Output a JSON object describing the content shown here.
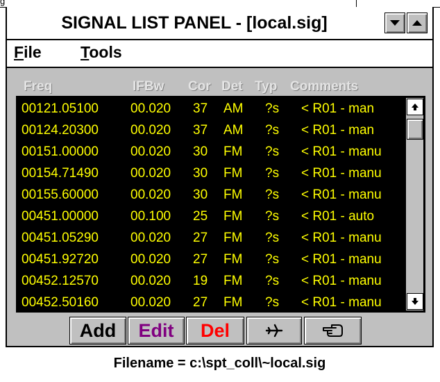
{
  "window": {
    "title": "SIGNAL LIST PANEL - [local.sig]",
    "top_fragment": "g"
  },
  "menu": {
    "file_accel": "F",
    "file_rest": "ile",
    "tools_accel": "T",
    "tools_rest": "ools"
  },
  "columns": [
    "Freq",
    "IFBw",
    "Cor",
    "Det",
    "Typ",
    "Comments"
  ],
  "rows": [
    {
      "freq": "00121.05100",
      "ifbw": "00.020",
      "cor": "37",
      "det": "AM",
      "typ": "?s",
      "comments": "< R01 - man"
    },
    {
      "freq": "00124.20300",
      "ifbw": "00.020",
      "cor": "37",
      "det": "AM",
      "typ": "?s",
      "comments": "< R01 - man"
    },
    {
      "freq": "00151.00000",
      "ifbw": "00.020",
      "cor": "30",
      "det": "FM",
      "typ": "?s",
      "comments": "< R01 - manu"
    },
    {
      "freq": "00154.71490",
      "ifbw": "00.020",
      "cor": "30",
      "det": "FM",
      "typ": "?s",
      "comments": "< R01 - manu"
    },
    {
      "freq": "00155.60000",
      "ifbw": "00.020",
      "cor": "30",
      "det": "FM",
      "typ": "?s",
      "comments": "< R01 - manu"
    },
    {
      "freq": "00451.00000",
      "ifbw": "00.100",
      "cor": "25",
      "det": "FM",
      "typ": "?s",
      "comments": "< R01 - auto"
    },
    {
      "freq": "00451.05290",
      "ifbw": "00.020",
      "cor": "27",
      "det": "FM",
      "typ": "?s",
      "comments": "< R01 - manu"
    },
    {
      "freq": "00451.92720",
      "ifbw": "00.020",
      "cor": "27",
      "det": "FM",
      "typ": "?s",
      "comments": "< R01 - manu"
    },
    {
      "freq": "00452.12570",
      "ifbw": "00.020",
      "cor": "19",
      "det": "FM",
      "typ": "?s",
      "comments": "< R01 - manu"
    },
    {
      "freq": "00452.50160",
      "ifbw": "00.020",
      "cor": "27",
      "det": "FM",
      "typ": "?s",
      "comments": "< R01 - manu"
    }
  ],
  "buttons": {
    "add": "Add",
    "edit": "Edit",
    "del": "Del",
    "plane_icon": "airplane-icon",
    "hand_icon": "pointing-hand-icon"
  },
  "colors": {
    "list_bg": "#000000",
    "list_text": "#ffff00",
    "edit": "#800080",
    "del": "#ff0000",
    "panel_bg": "#c0c0c0"
  },
  "status": {
    "filename": "Filename = c:\\spt_coll\\~local.sig"
  }
}
